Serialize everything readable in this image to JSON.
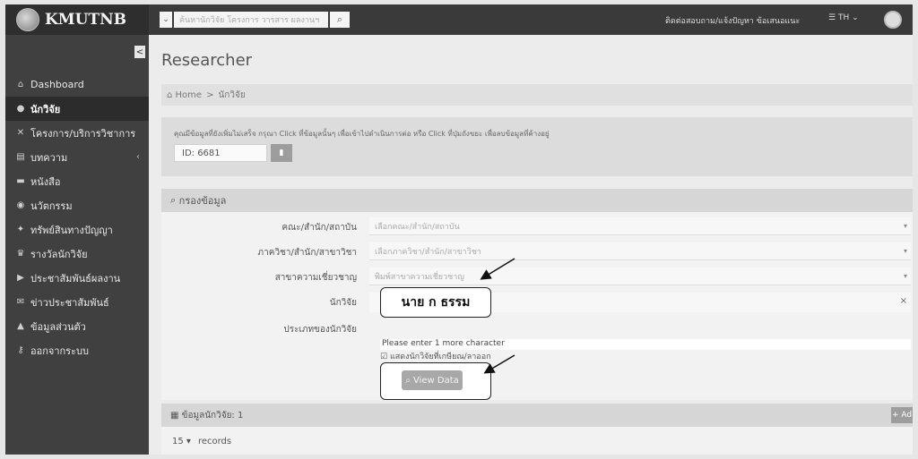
{
  "header": {
    "logo_text": "KMUTNB",
    "search_scope_icon": "chevron-down-icon",
    "search_placeholder": "ค้นหานักวิจัย โครงการ วารสาร ผลงานฯ",
    "search_icon": "search-icon",
    "contact_text": "ติดต่อสอบถาม/แจ้งปัญหา ข้อเสนอแนะ",
    "language_text": "TH"
  },
  "sidebar": {
    "collapse_glyph": "<",
    "items": [
      {
        "label": "Dashboard",
        "icon": "home-icon",
        "active": false,
        "has_children": false
      },
      {
        "label": "นักวิจัย",
        "icon": "user-icon",
        "active": true,
        "has_children": false
      },
      {
        "label": "โครงการ/บริการวิชาการ",
        "icon": "tools-icon",
        "active": false,
        "has_children": false
      },
      {
        "label": "บทความ",
        "icon": "article-icon",
        "active": false,
        "has_children": true
      },
      {
        "label": "หนังสือ",
        "icon": "book-icon",
        "active": false,
        "has_children": false
      },
      {
        "label": "นวัตกรรม",
        "icon": "lightbulb-icon",
        "active": false,
        "has_children": false
      },
      {
        "label": "ทรัพย์สินทางปัญญา",
        "icon": "handshake-icon",
        "active": false,
        "has_children": false
      },
      {
        "label": "รางวัลนักวิจัย",
        "icon": "trophy-icon",
        "active": false,
        "has_children": false
      },
      {
        "label": "ประชาสัมพันธ์ผลงาน",
        "icon": "video-icon",
        "active": false,
        "has_children": false
      },
      {
        "label": "ข่าวประชาสัมพันธ์",
        "icon": "news-icon",
        "active": false,
        "has_children": false
      },
      {
        "label": "ข้อมูลส่วนตัว",
        "icon": "profile-icon",
        "active": false,
        "has_children": false
      },
      {
        "label": "ออกจากระบบ",
        "icon": "key-icon",
        "active": false,
        "has_children": false
      }
    ]
  },
  "main": {
    "title": "Researcher",
    "breadcrumb": {
      "home": "Home",
      "separator": ">",
      "current": "นักวิจัย"
    },
    "info_message": "คุณมีข้อมูลที่ยังเพิ่มไม่เสร็จ กรุณา Click ที่ข้อมูลนั้นๆ เพื่อเข้าไปดำเนินการต่อ หรือ Click ที่ปุ่มถังขยะ เพื่อลบข้อมูลที่ค้างอยู่",
    "draft_id": "ID: 6681",
    "filter": {
      "heading": "กรองข้อมูล",
      "fields": [
        {
          "label": "คณะ/สำนัก/สถาบัน",
          "placeholder": "เลือกคณะ/สำนัก/สถาบัน"
        },
        {
          "label": "ภาควิชา/สำนัก/สาขาวิชา",
          "placeholder": "เลือกภาควิชา/สำนัก/สาขาวิชา"
        },
        {
          "label": "สาขาความเชี่ยวชาญ",
          "placeholder": "พิมพ์สาขาความเชี่ยวชาญ"
        },
        {
          "label": "นักวิจัย",
          "placeholder": ""
        },
        {
          "label": "ประเภทของนักวิจัย",
          "placeholder": ""
        }
      ],
      "researcher_callout": "นาย ก ธรรม",
      "clear_glyph": "×",
      "hint": "Please enter 1 more character",
      "checkbox_label": "แสดงนักวิจัยที่เกษียณ/ลาออก",
      "view_button": "View Data"
    },
    "results": {
      "heading": "ข้อมูลนักวิจัย: 1",
      "add_label": "+ Ad",
      "page_size": "15",
      "records_label": "records"
    }
  },
  "colors": {
    "sidebar_bg": "#404040",
    "active_item_bg": "#2c2c2c",
    "button_gray": "#a8a8a8",
    "annotation": "#111111"
  }
}
